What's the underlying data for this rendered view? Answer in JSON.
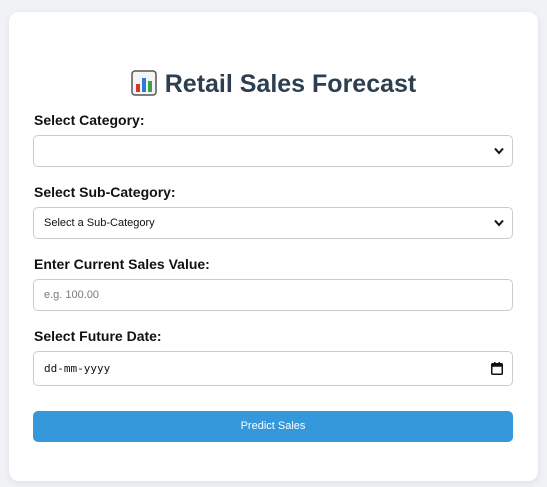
{
  "header": {
    "title": "Retail Sales Forecast",
    "icon": "bar-chart-icon"
  },
  "form": {
    "category_label": "Select Category:",
    "category_value": "",
    "subcategory_label": "Select Sub-Category:",
    "subcategory_value": "Select a Sub-Category",
    "sales_label": "Enter Current Sales Value:",
    "sales_placeholder": "e.g. 100.00",
    "date_label": "Select Future Date:",
    "date_value": "dd-mm-yyyy",
    "submit_label": "Predict Sales"
  },
  "colors": {
    "accent": "#3498db",
    "title": "#2c3e50",
    "page_background": "#f0f2f6"
  }
}
